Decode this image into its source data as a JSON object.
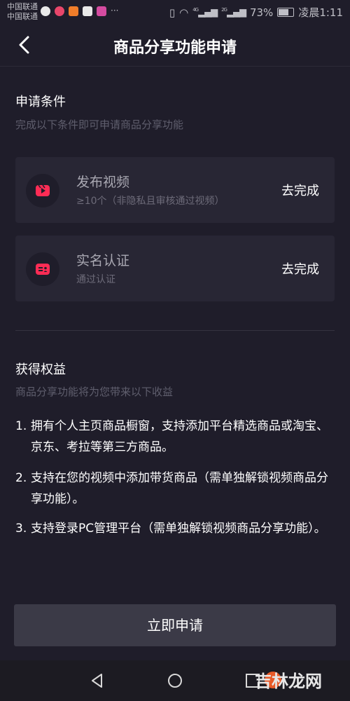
{
  "status_bar": {
    "carrier1": "中国联通",
    "carrier2": "中国联通",
    "more": "···",
    "network1": "4G",
    "network2": "2G",
    "battery": "73%",
    "time": "凌晨1:11"
  },
  "header": {
    "title": "商品分享功能申请"
  },
  "conditions": {
    "title": "申请条件",
    "subtitle": "完成以下条件即可申请商品分享功能",
    "items": [
      {
        "title": "发布视频",
        "desc": "≥10个（非隐私且审核通过视频）",
        "action": "去完成",
        "icon": "video-icon"
      },
      {
        "title": "实名认证",
        "desc": "通过认证",
        "action": "去完成",
        "icon": "id-card-icon"
      }
    ]
  },
  "benefits": {
    "title": "获得权益",
    "subtitle": "商品分享功能将为您带来以下收益",
    "items": [
      {
        "num": "1.",
        "text": "拥有个人主页商品橱窗，支持添加平台精选商品或淘宝、京东、考拉等第三方商品。"
      },
      {
        "num": "2.",
        "text": "支持在您的视频中添加带货商品（需单独解锁视频商品分享功能）。"
      },
      {
        "num": "3.",
        "text": "支持登录PC管理平台（需单独解锁视频商品分享功能）。"
      }
    ]
  },
  "apply_button": "立即申请",
  "watermark": "吉林龙网",
  "colors": {
    "background": "#1f1d2a",
    "card": "#282634",
    "accent": "#fe2c55"
  }
}
